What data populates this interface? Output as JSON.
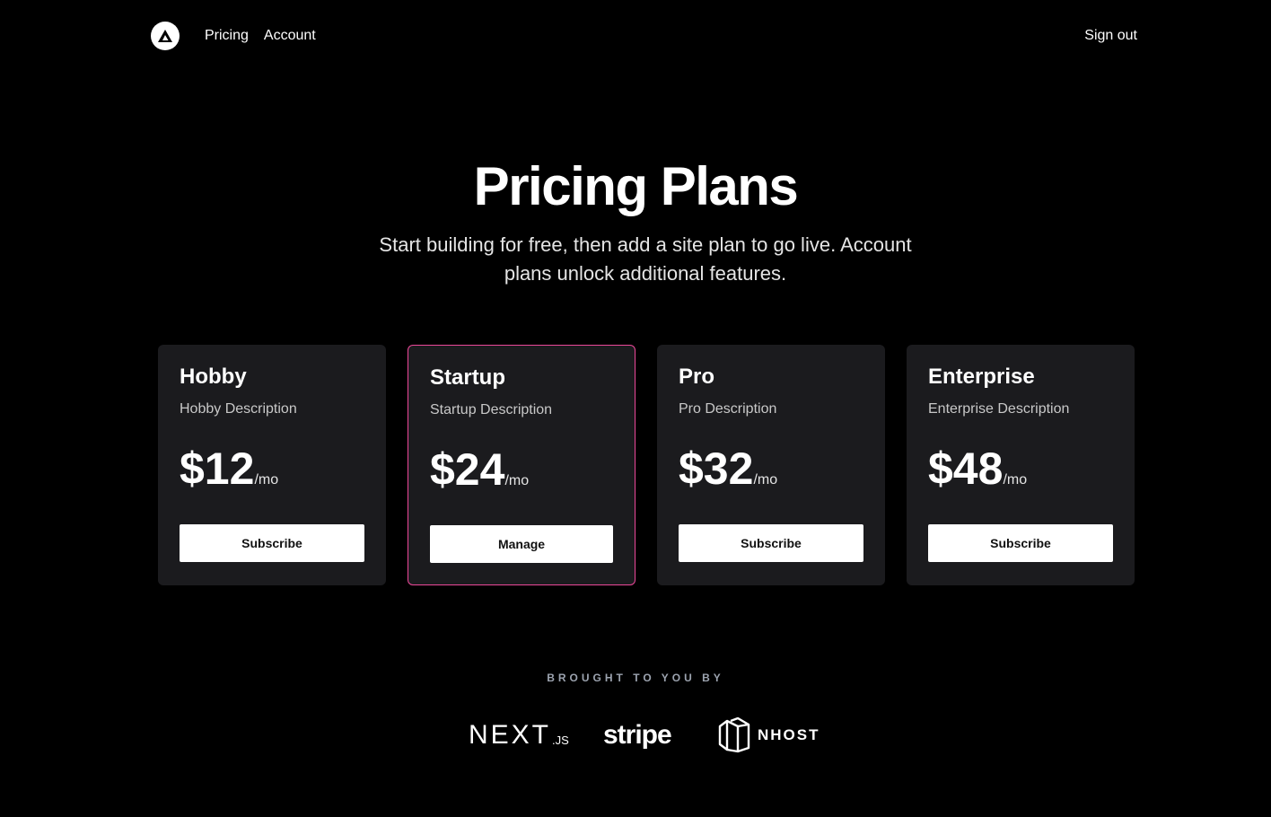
{
  "nav": {
    "logo_icon": "triangle-logo-icon",
    "links": [
      {
        "label": "Pricing"
      },
      {
        "label": "Account"
      }
    ],
    "sign_out": "Sign out"
  },
  "hero": {
    "title": "Pricing Plans",
    "subtitle": "Start building for free, then add a site plan to go live. Account plans unlock additional features."
  },
  "plans": [
    {
      "name": "Hobby",
      "description": "Hobby Description",
      "price": "$12",
      "period": "/mo",
      "button": "Subscribe",
      "active": false
    },
    {
      "name": "Startup",
      "description": "Startup Description",
      "price": "$24",
      "period": "/mo",
      "button": "Manage",
      "active": true
    },
    {
      "name": "Pro",
      "description": "Pro Description",
      "price": "$32",
      "period": "/mo",
      "button": "Subscribe",
      "active": false
    },
    {
      "name": "Enterprise",
      "description": "Enterprise Description",
      "price": "$48",
      "period": "/mo",
      "button": "Subscribe",
      "active": false
    }
  ],
  "sponsors": {
    "heading": "BROUGHT TO YOU BY",
    "items": [
      {
        "name": "NEXT",
        "suffix": ".JS",
        "icon": "nextjs-logo"
      },
      {
        "name": "stripe",
        "icon": "stripe-logo"
      },
      {
        "name": "NHOST",
        "icon": "nhost-logo"
      }
    ]
  },
  "colors": {
    "background": "#000000",
    "card": "#1b1b1e",
    "active_border": "#ec4899",
    "button": "#ffffff"
  }
}
